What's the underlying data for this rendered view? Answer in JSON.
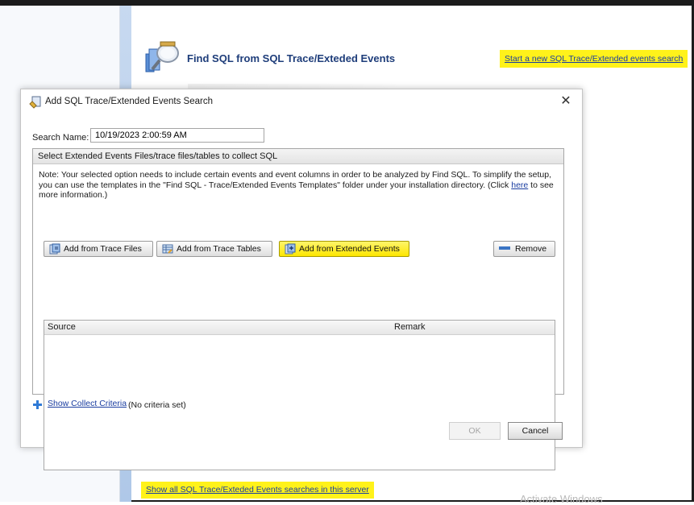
{
  "header": {
    "title": "Find SQL from SQL Trace/Exteded Events",
    "start_link": "Start a new SQL Trace/Extended events search",
    "show_all_link": "Show all SQL Trace/Exteded Events searches in this server",
    "watermark": "Activate Windows"
  },
  "dialog": {
    "title": "Add SQL Trace/Extended Events Search",
    "search_label": "Search Name:",
    "search_value": "10/19/2023 2:00:59 AM",
    "group_title": "Select Extended Events Files/trace files/tables to collect SQL",
    "note_text": "Note: Your selected option needs to include certain events and event columns in order to be analyzed by Find SQL. To simplify the setup, you can use the templates in the \"Find SQL - Trace/Extended Events Templates\" folder under your installation directory. (Click",
    "note_link": "here",
    "note_tail": "to see more information.)",
    "buttons": {
      "trace_files": "Add from Trace Files",
      "trace_tables": "Add from Trace Tables",
      "extended_events": "Add from Extended Events",
      "remove": "Remove"
    },
    "table": {
      "columns": [
        "Source",
        "Remark"
      ]
    },
    "criteria_link": "Show Collect Criteria",
    "criteria_status": "(No criteria set)",
    "ok_label": "OK",
    "cancel_label": "Cancel"
  },
  "colors": {
    "highlight": "#fff21a",
    "link": "#1a3da0",
    "title": "#1e3d7a"
  }
}
